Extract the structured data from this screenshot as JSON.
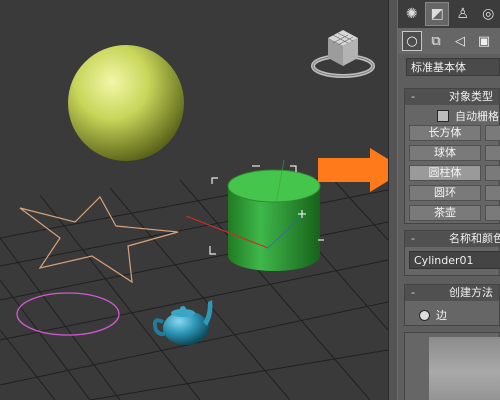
{
  "viewport": {
    "name": "perspective-viewport",
    "viewcube_label": "viewcube",
    "colors": {
      "sphere": "#c8d65a",
      "cylinder": "#3fb84a",
      "teapot": "#2e98b8",
      "star_outline": "#d7a27c",
      "circle_outline": "#d05ad0",
      "arrow": "#ff7a1a"
    }
  },
  "command_panel": {
    "tabs": [
      "create-tab",
      "modify-tab",
      "hierarchy-tab",
      "motion-tab"
    ],
    "categories": [
      "geometry",
      "shapes",
      "lights",
      "cameras"
    ],
    "primitive_type": "标准基本体",
    "object_type": {
      "title": "对象类型",
      "autogrid_label": "自动栅格",
      "buttons": [
        {
          "label": "长方体",
          "selected": false
        },
        {
          "label": "球体",
          "selected": false
        },
        {
          "label": "圆柱体",
          "selected": true
        },
        {
          "label": "圆环",
          "selected": false
        },
        {
          "label": "茶壶",
          "selected": false
        }
      ]
    },
    "name_color": {
      "title": "名称和颜色",
      "name_value": "Cylinder01"
    },
    "creation_method": {
      "title": "创建方法",
      "option_label": "边"
    }
  }
}
